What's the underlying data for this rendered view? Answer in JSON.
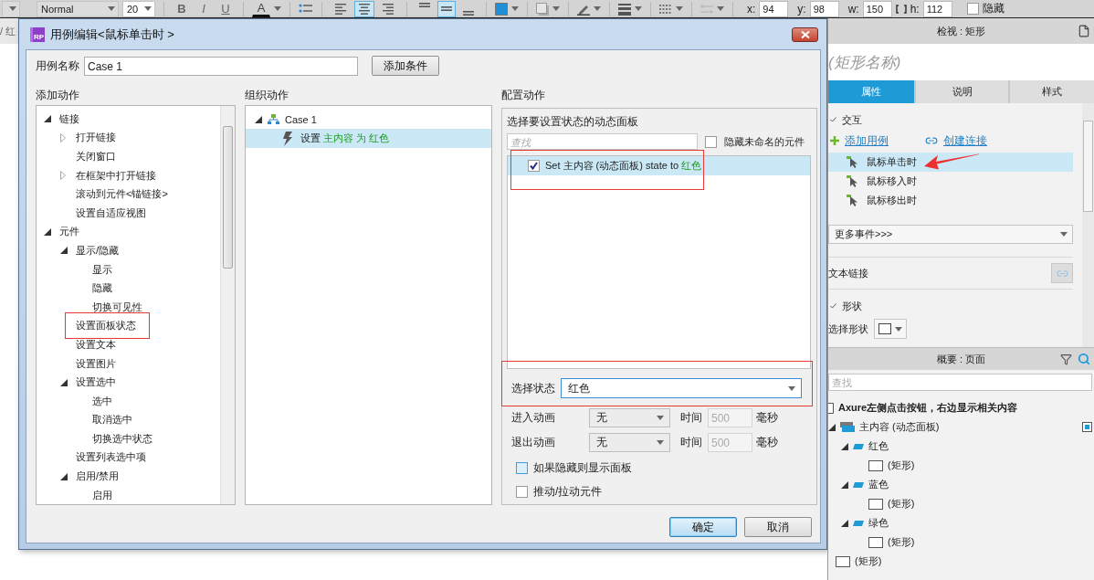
{
  "toolbar": {
    "font_style": "Normal",
    "font_size": "20",
    "format_buttons": [
      {
        "kind": "bold",
        "label": "B"
      },
      {
        "kind": "italic",
        "label": "I"
      },
      {
        "kind": "underline",
        "label": "U"
      }
    ],
    "font_color_label": "A",
    "align_buttons": [
      {
        "kind": "left",
        "selected": false
      },
      {
        "kind": "center",
        "selected": true
      },
      {
        "kind": "right",
        "selected": false
      }
    ],
    "valign_buttons": [
      {
        "kind": "top",
        "selected": false
      },
      {
        "kind": "middle",
        "selected": true
      },
      {
        "kind": "bottom",
        "selected": false
      }
    ],
    "geometry": [
      {
        "kind": "plain",
        "label": "x:",
        "value": "94"
      },
      {
        "kind": "plain",
        "label": "y:",
        "value": "98"
      },
      {
        "kind": "plain",
        "label": "w:",
        "value": "150"
      },
      {
        "kind": "with_lock",
        "label": "h:",
        "value": "112"
      }
    ],
    "hidden_checkbox": {
      "label": "隐藏",
      "checked": false
    }
  },
  "canvas_tab": "/ 红",
  "dialog": {
    "app_icon_label": "RP",
    "title": "用例编辑<鼠标单击时 >",
    "case_name": {
      "label": "用例名称",
      "value": "Case 1"
    },
    "add_condition_button": "添加条件",
    "add_actions": {
      "heading": "添加动作",
      "tree": [
        {
          "label": "链接",
          "expanded": true,
          "children": [
            {
              "label": "打开链接",
              "expanded": false
            },
            {
              "label": "关闭窗口"
            },
            {
              "label": "在框架中打开链接",
              "expanded": false
            },
            {
              "label": "滚动到元件<锚链接>"
            },
            {
              "label": "设置自适应视图"
            }
          ]
        },
        {
          "label": "元件",
          "expanded": true,
          "children": [
            {
              "label": "显示/隐藏",
              "expanded": true,
              "children": [
                {
                  "label": "显示"
                },
                {
                  "label": "隐藏"
                },
                {
                  "label": "切换可见性"
                }
              ]
            },
            {
              "label": "设置面板状态",
              "highlighted": true
            },
            {
              "label": "设置文本"
            },
            {
              "label": "设置图片"
            },
            {
              "label": "设置选中",
              "expanded": true,
              "children": [
                {
                  "label": "选中"
                },
                {
                  "label": "取消选中"
                },
                {
                  "label": "切换选中状态"
                }
              ]
            },
            {
              "label": "设置列表选中项"
            },
            {
              "label": "启用/禁用",
              "expanded": true,
              "children": [
                {
                  "label": "启用"
                }
              ]
            }
          ]
        }
      ]
    },
    "organize_actions": {
      "heading": "组织动作",
      "cases": [
        {
          "label": "Case 1",
          "expanded": true,
          "actions": [
            {
              "verb": "设置",
              "detail": "主内容 为 红色",
              "selected": true
            }
          ]
        }
      ]
    },
    "configure": {
      "heading": "配置动作",
      "panel_label": "选择要设置状态的动态面板",
      "search": {
        "placeholder": "查找"
      },
      "hide_unnamed": {
        "label": "隐藏未命名的元件",
        "checked": false
      },
      "rows": [
        {
          "text": "Set 主内容 (动态面板) state to",
          "value": "红色",
          "checked": true,
          "selected": true,
          "highlighted": true
        }
      ],
      "state": {
        "label": "选择状态",
        "value": "红色",
        "highlighted": true
      },
      "animations": [
        {
          "label": "进入动画",
          "value": "无",
          "time_label": "时间",
          "time": "500",
          "unit": "毫秒"
        },
        {
          "label": "退出动画",
          "value": "无",
          "time_label": "时间",
          "time": "500",
          "unit": "毫秒"
        }
      ],
      "options": [
        {
          "label": "如果隐藏则显示面板",
          "checked": false,
          "hovered": true
        },
        {
          "label": "推动/拉动元件",
          "checked": false,
          "hovered": false
        }
      ]
    },
    "buttons": [
      {
        "label": "确定",
        "kind": "primary"
      },
      {
        "label": "取消",
        "kind": "normal"
      }
    ]
  },
  "inspector": {
    "title": "检视 : 矩形",
    "name_placeholder": "(矩形名称)",
    "tabs": [
      {
        "label": "属性",
        "selected": true
      },
      {
        "label": "说明",
        "selected": false
      },
      {
        "label": "样式",
        "selected": false
      }
    ],
    "interaction": {
      "heading": "交互",
      "add_case": "添加用例",
      "create_link": "创建连接",
      "events": [
        {
          "label": "鼠标单击时",
          "selected": true,
          "pointed_at": true
        },
        {
          "label": "鼠标移入时",
          "selected": false
        },
        {
          "label": "鼠标移出时",
          "selected": false
        }
      ],
      "more_events": "更多事件>>>"
    },
    "text_link": "文本链接",
    "shape": {
      "heading": "形状",
      "select_label": "选择形状"
    }
  },
  "outline": {
    "title": "概要 : 页面",
    "search": {
      "placeholder": "查找"
    },
    "tree": [
      {
        "kind": "page",
        "label": "Axure左侧点击按钮，右边显示相关内容",
        "children": [
          {
            "kind": "dynamic_panel",
            "label": "主内容 (动态面板)",
            "expanded": true,
            "children": [
              {
                "kind": "state",
                "label": "红色",
                "expanded": true,
                "children": [
                  {
                    "kind": "shape",
                    "label": "(矩形)"
                  }
                ]
              },
              {
                "kind": "state",
                "label": "蓝色",
                "expanded": true,
                "children": [
                  {
                    "kind": "shape",
                    "label": "(矩形)"
                  }
                ]
              },
              {
                "kind": "state",
                "label": "绿色",
                "expanded": true,
                "children": [
                  {
                    "kind": "shape",
                    "label": "(矩形)"
                  }
                ]
              }
            ]
          },
          {
            "kind": "shape",
            "label": "(矩形)"
          }
        ]
      }
    ]
  }
}
